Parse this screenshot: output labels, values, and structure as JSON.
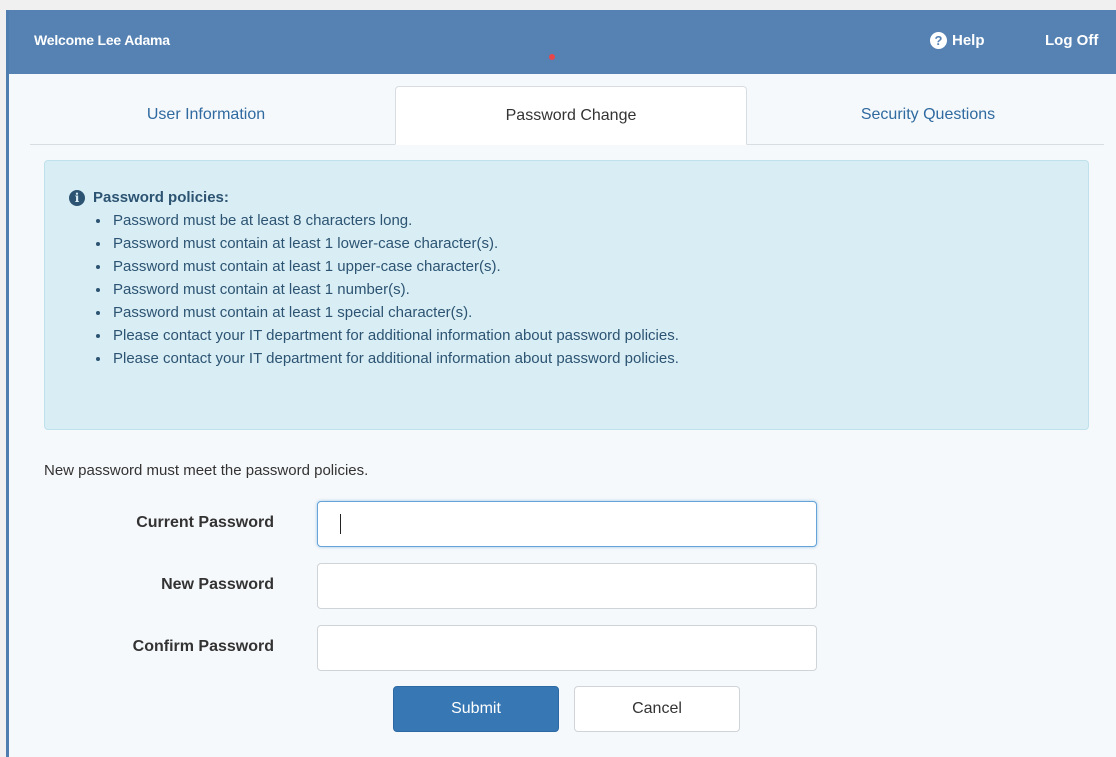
{
  "header": {
    "welcome": "Welcome Lee Adama",
    "help_label": "Help",
    "logoff_label": "Log Off",
    "background_color": "#5582b3"
  },
  "tabs": [
    {
      "label": "User Information",
      "active": false
    },
    {
      "label": "Password Change",
      "active": true
    },
    {
      "label": "Security Questions",
      "active": false
    }
  ],
  "policies": {
    "title": "Password policies:",
    "icon": "info-circle-icon",
    "items": [
      "Password must be at least 8 characters long.",
      "Password must contain at least 1 lower-case character(s).",
      "Password must contain at least 1 upper-case character(s).",
      "Password must contain at least 1 number(s).",
      "Password must contain at least 1 special character(s).",
      "Please contact your IT department for additional information about password policies.",
      "Please contact your IT department for additional information about password policies."
    ],
    "background_color": "#d9edf5"
  },
  "form": {
    "instruction": "New password must meet the password policies.",
    "fields": [
      {
        "label": "Current Password",
        "value": "",
        "focused": true
      },
      {
        "label": "New Password",
        "value": "",
        "focused": false
      },
      {
        "label": "Confirm Password",
        "value": "",
        "focused": false
      }
    ],
    "submit_label": "Submit",
    "cancel_label": "Cancel",
    "accent_color": "#3777b3"
  }
}
